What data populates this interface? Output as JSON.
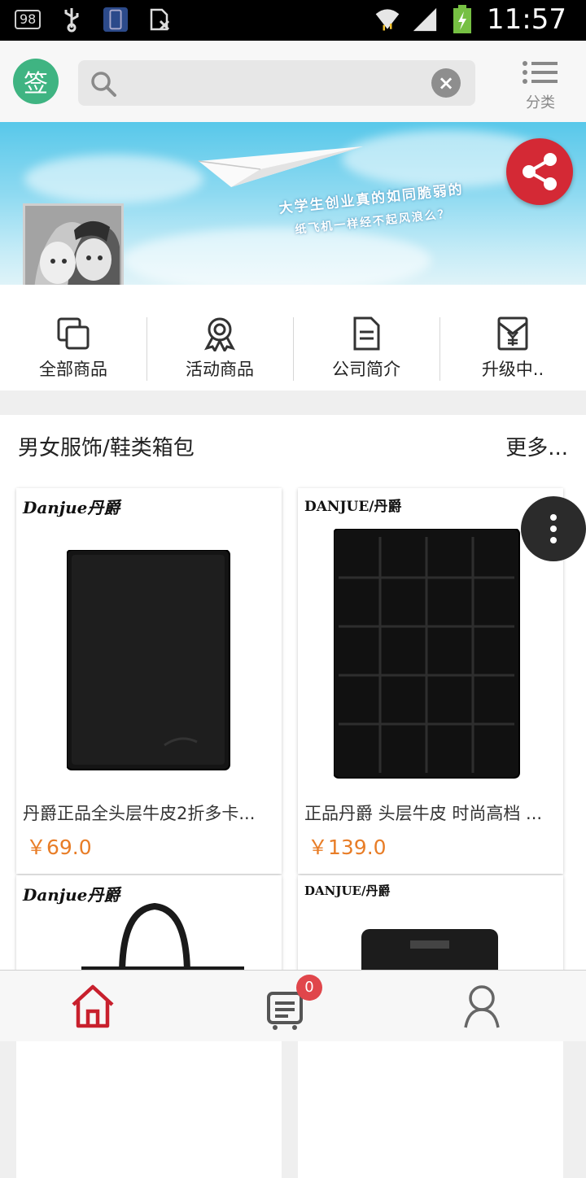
{
  "status_bar": {
    "notification_count": "98",
    "time": "11:57"
  },
  "header": {
    "sign_label": "签",
    "search_placeholder": "",
    "category_label": "分类"
  },
  "banner": {
    "line1": "大学生创业真的如同脆弱的",
    "line2": "纸飞机一样经不起风浪么？"
  },
  "nav": [
    {
      "label": "全部商品",
      "icon": "all-products-icon"
    },
    {
      "label": "活动商品",
      "icon": "promotion-icon"
    },
    {
      "label": "公司简介",
      "icon": "company-profile-icon"
    },
    {
      "label": "升级中..",
      "icon": "upgrading-icon"
    }
  ],
  "section": {
    "title": "男女服饰/鞋类箱包",
    "more_label": "更多..."
  },
  "products": [
    {
      "brand": "Danjue丹爵",
      "name": "丹爵正品全头层牛皮2折多卡...",
      "price": "￥69.0"
    },
    {
      "brand": "DANJUE/丹爵",
      "name": "正品丹爵 头层牛皮 时尚高档 ...",
      "price": "￥139.0"
    },
    {
      "brand": "Danjue丹爵",
      "name": "",
      "price": ""
    },
    {
      "brand": "DANJUE/丹爵",
      "name": "",
      "price": ""
    }
  ],
  "bottom_nav": {
    "cart_count": "0"
  },
  "colors": {
    "accent_red": "#c8202d",
    "price_orange": "#e87d27",
    "sign_green": "#3fb482"
  }
}
